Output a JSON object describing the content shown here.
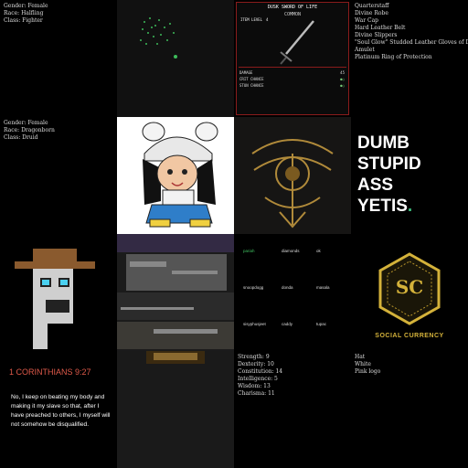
{
  "tiles": {
    "hobbit": {
      "lines": [
        "Gender: Female",
        "Race: Halfling",
        "Class: Fighter"
      ]
    },
    "druid": {
      "lines": [
        "Gender: Female",
        "Race: Dragonborn",
        "Class: Druid"
      ]
    },
    "items": {
      "lines": [
        "Quarterstaff",
        "Divine Robe",
        "War Cap",
        "Hard Leather Belt",
        "Divine Slippers",
        "\"Soul Glow\" Studded Leather Gloves of Detection",
        "Amulet",
        "Platinum Ring of Protection"
      ]
    },
    "sword": {
      "title": "DUSK SWORD OF LIFE",
      "rarity": "COMMON",
      "level_label": "ITEM LEVEL",
      "level_value": "4",
      "damage_label": "DAMAGE",
      "damage_value": "45",
      "crit_label": "CRIT CHANCE",
      "stun_label": "STUN CHANCE",
      "colors": {
        "border": "#8a1c1c",
        "good": "#7c7"
      }
    },
    "slogan": {
      "line1": "DUMB",
      "line2": "STUPID",
      "line3": "ASS",
      "line4": "YETIS",
      "dot": "."
    },
    "names": {
      "grid": [
        [
          "pariah",
          "diamonds",
          "ok"
        ],
        [
          "snoopdogg",
          "donda",
          "masala"
        ],
        [
          "sisyphusjeet",
          "caddy",
          "tupac"
        ]
      ]
    },
    "social": {
      "caption": "SOCIAL CURRENCY",
      "logo_letters": "SC",
      "color": "#d4b23a"
    },
    "verse": {
      "reference": "1 CORINTHIANS 9:27",
      "text": "No, I keep on beating my body and making it my slave so that, after I have preached to others, I myself will not somehow be disqualified."
    },
    "stats": {
      "lines": [
        "Strength: 9",
        "Dexterity: 10",
        "Constitution: 14",
        "Intelligence: 5",
        "Wisdom: 13",
        "Charisma: 11"
      ]
    },
    "hat": {
      "lines": [
        "Hat",
        "White",
        "Pink logo"
      ]
    }
  }
}
